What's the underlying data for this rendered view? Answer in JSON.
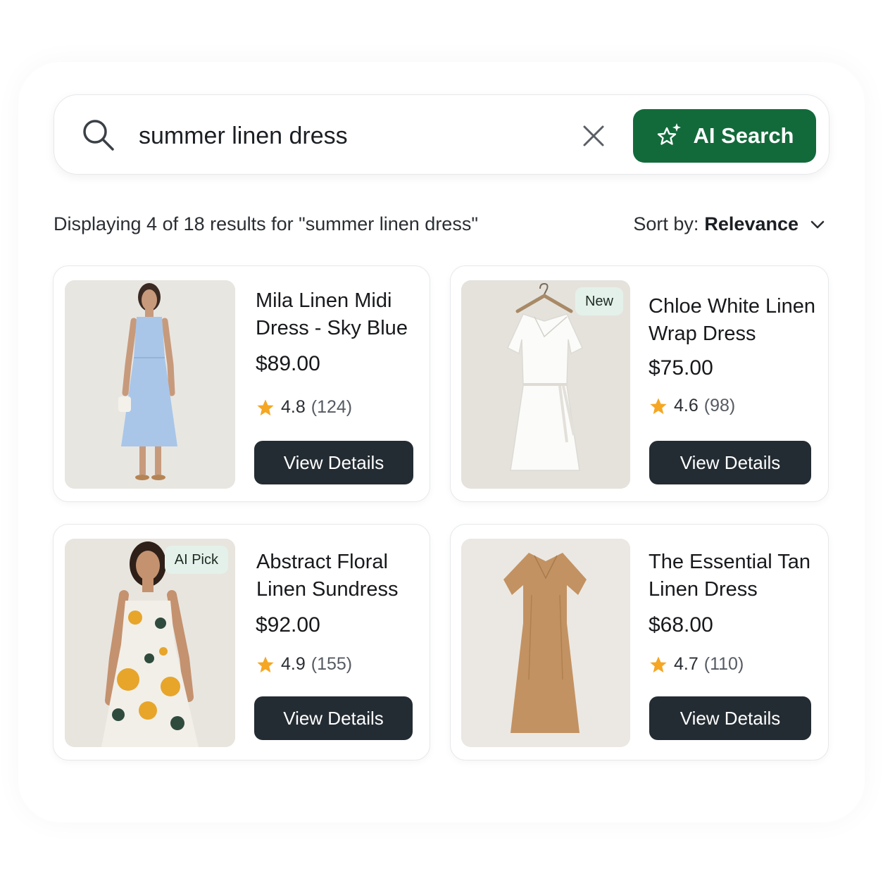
{
  "search": {
    "query": "summer linen dress",
    "ai_button_label": "AI Search"
  },
  "results": {
    "summary": "Displaying 4 of 18 results for \"summer linen dress\"",
    "sort_label": "Sort by:",
    "sort_value": "Relevance"
  },
  "products": [
    {
      "title_line1": "Mila Linen Midi",
      "title_line2": "Dress - Sky Blue",
      "price": "$89.00",
      "rating": "4.8",
      "reviews": "(124)",
      "badge": "",
      "button": "View Details"
    },
    {
      "title_line1": "Chloe White Linen",
      "title_line2": "Wrap Dress",
      "price": "$75.00",
      "rating": "4.6",
      "reviews": "(98)",
      "badge": "New",
      "button": "View Details"
    },
    {
      "title_line1": "Abstract Floral",
      "title_line2": "Linen Sundress",
      "price": "$92.00",
      "rating": "4.9",
      "reviews": "(155)",
      "badge": "AI Pick",
      "button": "View Details"
    },
    {
      "title_line1": "The Essential Tan",
      "title_line2": "Linen Dress",
      "price": "$68.00",
      "rating": "4.7",
      "reviews": "(110)",
      "badge": "",
      "button": "View Details"
    }
  ],
  "icons": {
    "search": "search-icon",
    "clear": "close-icon",
    "ai": "sparkle-star-icon",
    "sort": "chevron-down-icon",
    "rating": "star-icon"
  },
  "colors": {
    "ai_button": "#126a3a",
    "view_button": "#242c33",
    "star": "#f5a623",
    "badge_bg": "#e4f1ea"
  }
}
